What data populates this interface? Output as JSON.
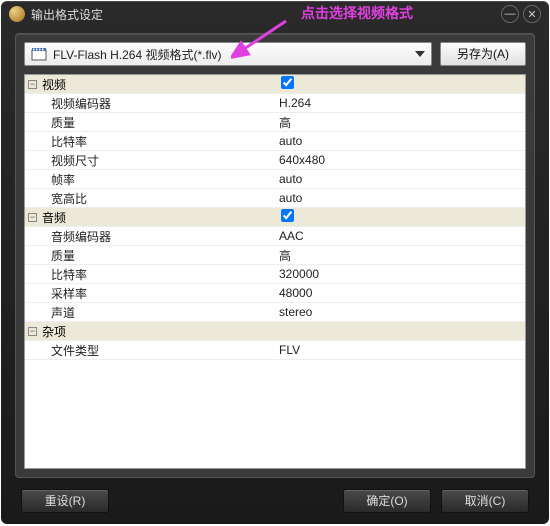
{
  "window": {
    "title": "输出格式设定"
  },
  "annotation": "点击选择视频格式",
  "format": {
    "selected": "FLV-Flash H.264 视频格式(*.flv)"
  },
  "saveAs": "另存为(A)",
  "sections": {
    "video": {
      "title": "视频",
      "checked": true,
      "rows": {
        "encoder": {
          "label": "视频编码器",
          "value": "H.264"
        },
        "quality": {
          "label": "质量",
          "value": "高"
        },
        "bitrate": {
          "label": "比特率",
          "value": "auto"
        },
        "size": {
          "label": "视频尺寸",
          "value": "640x480"
        },
        "framerate": {
          "label": "帧率",
          "value": "auto"
        },
        "aspect": {
          "label": "宽高比",
          "value": "auto"
        }
      }
    },
    "audio": {
      "title": "音频",
      "checked": true,
      "rows": {
        "encoder": {
          "label": "音频编码器",
          "value": "AAC"
        },
        "quality": {
          "label": "质量",
          "value": "高"
        },
        "bitrate": {
          "label": "比特率",
          "value": "320000"
        },
        "sample": {
          "label": "采样率",
          "value": "48000"
        },
        "channel": {
          "label": "声道",
          "value": "stereo"
        }
      }
    },
    "misc": {
      "title": "杂项",
      "rows": {
        "filetype": {
          "label": "文件类型",
          "value": "FLV"
        }
      }
    }
  },
  "footer": {
    "reset": "重设(R)",
    "ok": "确定(O)",
    "cancel": "取消(C)"
  }
}
